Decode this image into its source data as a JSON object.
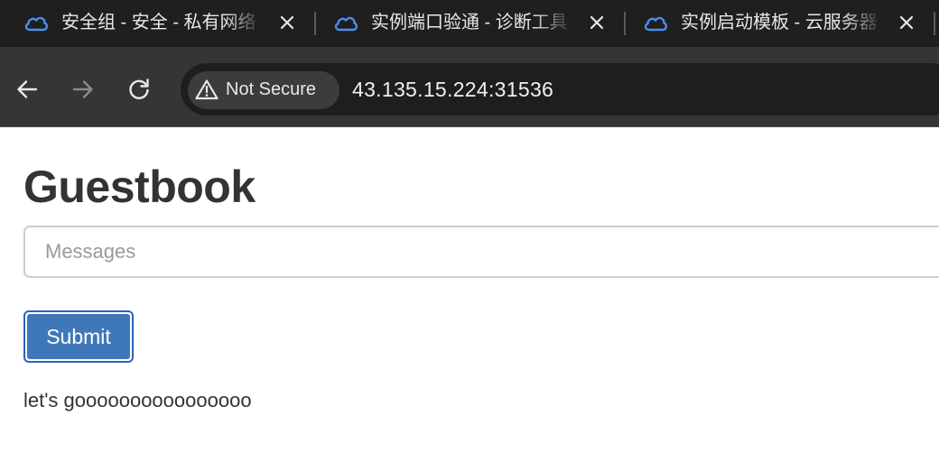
{
  "browser": {
    "tabs": [
      {
        "title": "安全组 - 安全 - 私有网络",
        "icon": "cloud-icon"
      },
      {
        "title": "实例端口验通 - 诊断工具",
        "icon": "cloud-icon"
      },
      {
        "title": "实例启动模板 - 云服务器",
        "icon": "cloud-icon"
      }
    ],
    "security_chip": "Not Secure",
    "url": "43.135.15.224:31536"
  },
  "page": {
    "heading": "Guestbook",
    "input_placeholder": "Messages",
    "input_value": "",
    "submit_label": "Submit",
    "entries": [
      "let's goooooooooooooooo"
    ]
  },
  "colors": {
    "tabstrip_bg": "#1f1f1f",
    "toolbar_bg": "#353535",
    "omnibox_bg": "#1e1e1e",
    "cloud_icon": "#4a8ff0",
    "button_bg": "#3f78b8",
    "button_focus_ring": "#2b63b8",
    "heading_text": "#333333"
  }
}
